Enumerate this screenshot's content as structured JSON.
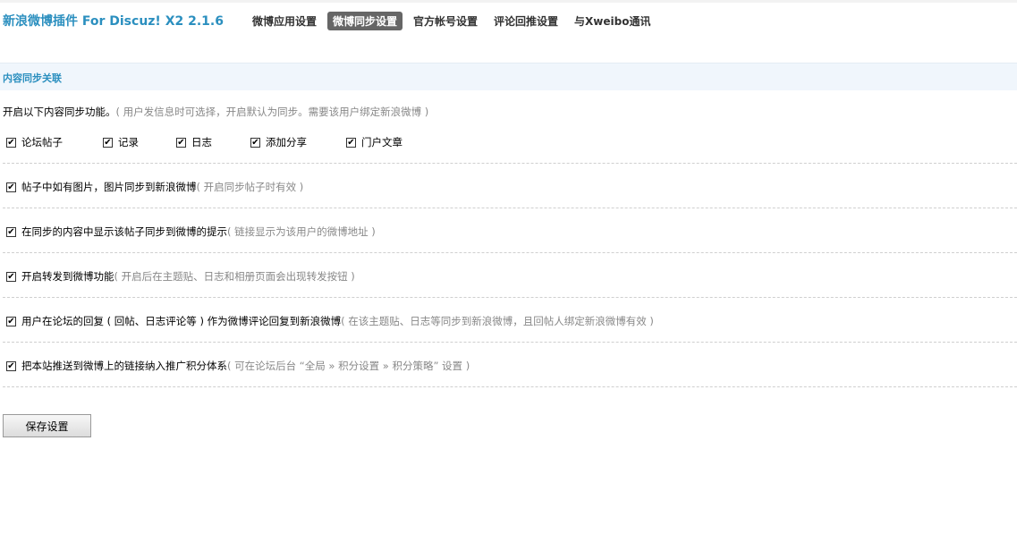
{
  "header": {
    "title": "新浪微博插件 For Discuz! X2 2.1.6",
    "tabs": [
      {
        "label": "微博应用设置",
        "active": false
      },
      {
        "label": "微博同步设置",
        "active": true
      },
      {
        "label": "官方帐号设置",
        "active": false
      },
      {
        "label": "评论回推设置",
        "active": false
      },
      {
        "label": "与Xweibo通讯",
        "active": false
      }
    ]
  },
  "section": {
    "title": "内容同步关联",
    "intro": "开启以下内容同步功能。",
    "intro_hint": "( 用户发信息时可选择，开启默认为同步。需要该用户绑定新浪微博 )",
    "sync_types": [
      {
        "label": "论坛帖子",
        "checked": true
      },
      {
        "label": "记录",
        "checked": true
      },
      {
        "label": "日志",
        "checked": true
      },
      {
        "label": "添加分享",
        "checked": true
      },
      {
        "label": "门户文章",
        "checked": true
      }
    ],
    "options": [
      {
        "label": "帖子中如有图片，图片同步到新浪微博",
        "hint": "( 开启同步帖子时有效 )",
        "checked": true
      },
      {
        "label": "在同步的内容中显示该帖子同步到微博的提示",
        "hint": "( 链接显示为该用户的微博地址 )",
        "checked": true
      },
      {
        "label": "开启转发到微博功能",
        "hint": "( 开启后在主题贴、日志和相册页面会出现转发按钮 )",
        "checked": true
      },
      {
        "label": "用户在论坛的回复 ( 回帖、日志评论等 ) 作为微博评论回复到新浪微博",
        "hint": "( 在该主题贴、日志等同步到新浪微博，且回帖人绑定新浪微博有效 )",
        "checked": true
      },
      {
        "label": "把本站推送到微博上的链接纳入推广积分体系",
        "hint": "( 可在论坛后台 “全局 » 积分设置 » 积分策略” 设置 )",
        "checked": true
      }
    ]
  },
  "check_mark": "✔",
  "save_label": "保存设置"
}
